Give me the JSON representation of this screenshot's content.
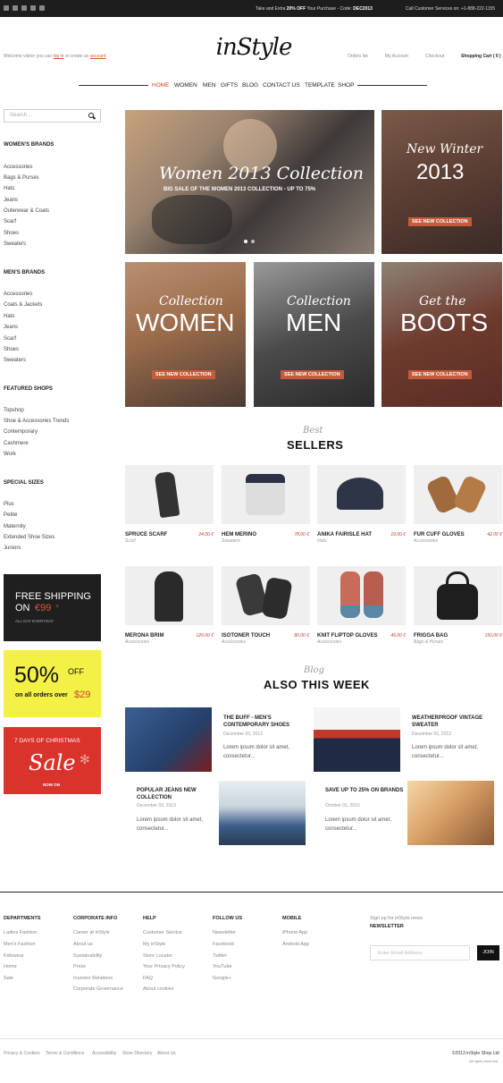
{
  "topbar": {
    "social_icons": [
      "linkedin-icon",
      "google-plus-icon",
      "twitter-icon",
      "instagram-icon",
      "facebook-icon"
    ],
    "promo_prefix": "Take and Extra ",
    "promo_bold": "20% OFF",
    "promo_middle": " Your Purchase - Code: ",
    "promo_code": "DEC2013",
    "service": "Call Customer Services on: +1-888-222-1155"
  },
  "header": {
    "welcome_prefix": "Welcome visitor you can ",
    "login": "log in",
    "welcome_middle": " or create an ",
    "account": "account",
    "logo": "inStyle",
    "account_links": [
      "Orders list",
      "My Account",
      "Checkout"
    ],
    "cart": "Shopping Cart ( 0 )"
  },
  "nav": [
    "HOME",
    "WOMEN",
    "MEN",
    "GIFTS",
    "BLOG",
    "CONTACT US",
    "TEMPLATE",
    "SHOP"
  ],
  "search": {
    "placeholder": "Search ..."
  },
  "sidebar": {
    "groups": [
      {
        "title": "WOMEN'S BRANDS",
        "items": [
          "Accessories",
          "Bags & Purses",
          "Hats",
          "Jeans",
          "Outerwear & Coats",
          "Scarf",
          "Shoes",
          "Sweaters"
        ]
      },
      {
        "title": "MEN'S BRANDS",
        "items": [
          "Accessories",
          "Coats & Jackets",
          "Hats",
          "Jeans",
          "Scarf",
          "Shoes",
          "Sweaters"
        ]
      },
      {
        "title": "FEATURED SHOPS",
        "items": [
          "Topshop",
          "Shoe & Accessories Trends",
          "Contemporary",
          "Cashmere",
          "Work"
        ]
      },
      {
        "title": "SPECIAL SIZES",
        "items": [
          "Plus",
          "Petite",
          "Maternity",
          "Extended Shoe Sizes",
          "Juniors"
        ]
      }
    ],
    "promos": {
      "shipping_line1": "FREE SHIPPING",
      "shipping_line2": "ON",
      "shipping_amount": "€99",
      "shipping_plus": "+",
      "shipping_sub": "ALL DAY EVERYDAY",
      "discount_big": "50%",
      "discount_off": "OFF",
      "discount_line": "on all orders over",
      "discount_amount": "$29",
      "xmas_top": "7 DAYS OF CHRISTMAS",
      "xmas_big": "Sale",
      "xmas_now": "NOW ON"
    }
  },
  "heroes": {
    "main_script": "Women 2013 Collection",
    "main_sub": "BIG SALE OF THE WOMEN 2013 COLLECTION - UP TO 75%",
    "winter_script": "New Winter",
    "winter_year": "2013",
    "winter_btn": "SEE NEW COLLECTION",
    "women_script": "Collection",
    "women_big": "WOMEN",
    "men_script": "Collection",
    "men_big": "MEN",
    "boots_script": "Get the",
    "boots_big": "BOOTS",
    "btn": "SEE NEW COLLECTION"
  },
  "bestsellers": {
    "script": "Best",
    "title": "SELLERS",
    "products": [
      {
        "name": "SPRUCE SCARF",
        "price": "24.00 €",
        "category": "Scarf"
      },
      {
        "name": "HEM MERINO",
        "price": "78.00 €",
        "category": "Sweaters"
      },
      {
        "name": "ANIKA FAIRISLE HAT",
        "price": "19.00 €",
        "category": "Hats"
      },
      {
        "name": "FUR CUFF GLOVES",
        "price": "42.00 €",
        "category": "Accessories"
      },
      {
        "name": "MERONA BRIM",
        "price": "120.00 €",
        "category": "Accessories"
      },
      {
        "name": "ISOTONER TOUCH",
        "price": "80.00 €",
        "category": "Accessories"
      },
      {
        "name": "KNIT FLIPTOP GLOVES",
        "price": "45.00 €",
        "category": "Accessories"
      },
      {
        "name": "FRIGGA BAG",
        "price": "150.00 €",
        "category": "Bags & Purses"
      }
    ]
  },
  "blog": {
    "script": "Blog",
    "title": "ALSO THIS WEEK",
    "posts": [
      {
        "title": "THE BUFF - MEN'S CONTEMPORARY SHOES",
        "date": "December 03, 2013",
        "text": "Lorem ipsum dolor sit amet, consectetur..."
      },
      {
        "title": "WEATHERPROOF VINTAGE SWEATER",
        "date": "December 03, 2013",
        "text": "Lorem ipsum dolor sit amet, consectetur..."
      },
      {
        "title": "POPULAR JEANS NEW COLLECTION",
        "date": "December 03, 2013",
        "text": "Lorem ipsum dolor sit amet, consectetur..."
      },
      {
        "title": "SAVE UP TO 25% ON BRANDS",
        "date": "October 01, 2013",
        "text": "Lorem ipsum dolor sit amet, consectetur..."
      }
    ]
  },
  "footer": {
    "columns": [
      {
        "title": "DEPARTMENTS",
        "items": [
          "Ladies Fashion",
          "Men's Fashion",
          "Kidswear",
          "Home",
          "Sale"
        ]
      },
      {
        "title": "CORPORATE INFO",
        "items": [
          "Career at inStyle",
          "About us",
          "Sustainability",
          "Press",
          "Investor Relations",
          "Corporate Governance"
        ]
      },
      {
        "title": "HELP",
        "items": [
          "Customer Service",
          "My inStyle",
          "Store Locator",
          "Your Privacy Policy",
          "FAQ",
          "About cookies"
        ]
      },
      {
        "title": "FOLLOW US",
        "items": [
          "Newsletter",
          "Facebook",
          "Twitter",
          "YouTube",
          "Google+"
        ]
      },
      {
        "title": "MOBILE",
        "items": [
          "iPhone App",
          "Android App"
        ]
      }
    ],
    "newsletter_sub": "Sign up for inStyle news",
    "newsletter_title": "NEWSLETTER",
    "email_placeholder": "Enter Email Address",
    "join": "JOIN",
    "bottom_links": [
      "Privacy & Cookies",
      "Terms & Conditions",
      "Accessibility",
      "Store Directory",
      "About Us"
    ],
    "copyright": "©2013 inStyle Shop Ltd",
    "rights": "All rights reserved"
  },
  "colors": {
    "accent": "#d0442a",
    "button": "#c45b3a",
    "dark": "#1d1d1d",
    "promo_yellow": "#f3f046",
    "promo_red": "#d9332b"
  }
}
